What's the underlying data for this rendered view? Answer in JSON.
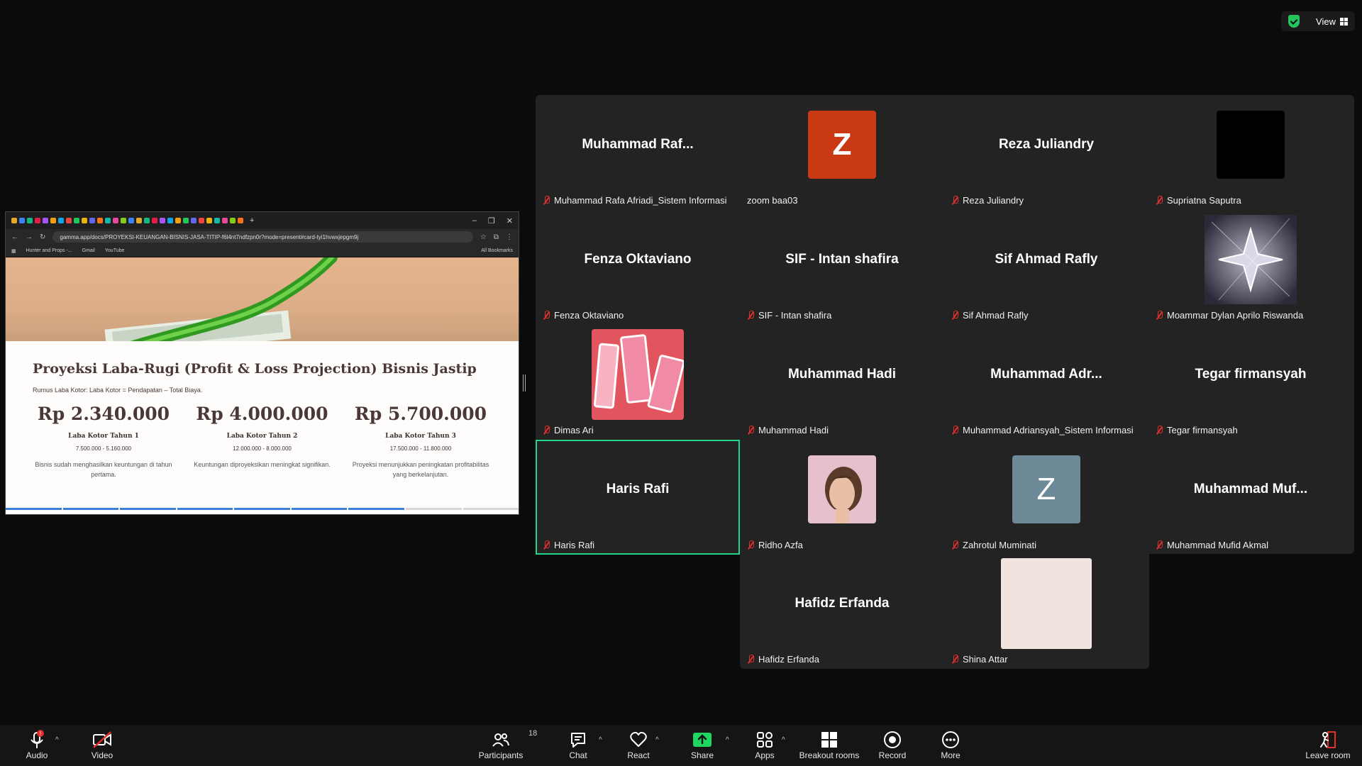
{
  "top_right": {
    "view_label": "View"
  },
  "browser": {
    "url": "gamma.app/docs/PROYEKSI-KEUANGAN-BISNIS-JASA-TITIP-f6l4nt7ndfzpn0r?mode=present#card-tyi1hvwxjepgm9j",
    "bookmarks": [
      "Hunter and Props -...",
      "Gmail",
      "YouTube"
    ],
    "all_bookmarks": "All Bookmarks"
  },
  "doc": {
    "title": "Proyeksi Laba-Rugi (Profit & Loss Projection) Bisnis Jastip",
    "subtitle": "Rumus Laba Kotor: Laba Kotor = Pendapatan – Total Biaya.",
    "cards": [
      {
        "value": "Rp 2.340.000",
        "label": "Laba Kotor Tahun 1",
        "range": "7.500.000 - 5.160.000",
        "desc": "Bisnis sudah menghasilkan keuntungan di tahun pertama."
      },
      {
        "value": "Rp 4.000.000",
        "label": "Laba Kotor Tahun 2",
        "range": "12.000.000 - 8.000.000",
        "desc": "Keuntungan diproyeksikan meningkat signifikan."
      },
      {
        "value": "Rp 5.700.000",
        "label": "Laba Kotor Tahun 3",
        "range": "17.500.000 - 11.800.000",
        "desc": "Proyeksi menunjukkan peningkatan profitabilitas yang berkelanjutan."
      }
    ]
  },
  "participants": [
    {
      "display": "Muhammad  Raf...",
      "name": "Muhammad Rafa Afriadi_Sistem Informasi"
    },
    {
      "display": "Z",
      "name": "zoom baa03",
      "avatar_color": "#c93a14"
    },
    {
      "display": "Reza Juliandry",
      "name": "Reza Juliandry"
    },
    {
      "display": "",
      "name": "Supriatna Saputra",
      "avatar_color": "#000000"
    },
    {
      "display": "Fenza Oktaviano",
      "name": "Fenza Oktaviano"
    },
    {
      "display": "SIF - Intan shafira",
      "name": "SIF - Intan shafira"
    },
    {
      "display": "Sif Ahmad Rafly",
      "name": "Sif Ahmad Rafly"
    },
    {
      "display": "",
      "name": "Moammar Dylan Aprilo Riswanda"
    },
    {
      "display": "",
      "name": "Dimas Ari"
    },
    {
      "display": "Muhammad Hadi",
      "name": "Muhammad Hadi"
    },
    {
      "display": "Muhammad  Adr...",
      "name": "Muhammad Adriansyah_Sistem Informasi"
    },
    {
      "display": "Tegar firmansyah",
      "name": "Tegar firmansyah"
    },
    {
      "display": "Haris Rafi",
      "name": "Haris Rafi"
    },
    {
      "display": "",
      "name": "Ridho Azfa"
    },
    {
      "display": "Z",
      "name": "Zahrotul Muminati",
      "avatar_color": "#6e8a99"
    },
    {
      "display": "Muhammad  Muf...",
      "name": "Muhammad Mufid Akmal"
    },
    {
      "display": "Hafidz Erfanda",
      "name": "Hafidz Erfanda"
    },
    {
      "display": "",
      "name": "Shina Attar",
      "avatar_color": "#f1e4de"
    }
  ],
  "toolbar": {
    "audio": "Audio",
    "video": "Video",
    "participants": "Participants",
    "participants_count": "18",
    "chat": "Chat",
    "react": "React",
    "share": "Share",
    "apps": "Apps",
    "breakout": "Breakout rooms",
    "record": "Record",
    "more": "More",
    "leave": "Leave room"
  }
}
